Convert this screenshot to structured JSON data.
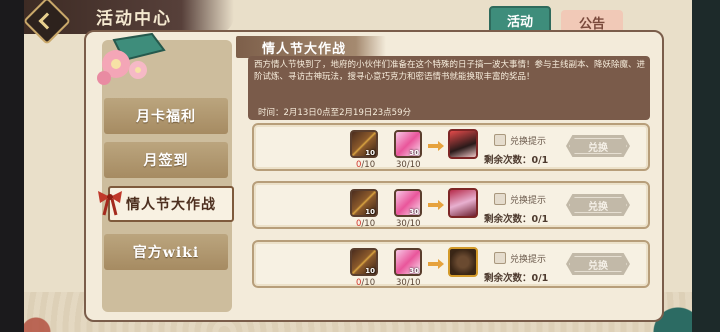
{
  "header": {
    "title": "活动中心",
    "back_icon": "back-diamond-icon"
  },
  "tabs": [
    {
      "label": "活动",
      "active": true
    },
    {
      "label": "公告",
      "active": false
    }
  ],
  "menu": [
    {
      "label": "月卡福利",
      "active": false
    },
    {
      "label": "月签到",
      "active": false
    },
    {
      "label": "情人节大作战",
      "active": true
    },
    {
      "label": "官方wiki",
      "active": false
    }
  ],
  "event": {
    "title": "情人节大作战",
    "description": "西方情人节快到了，地府的小伙伴们准备在这个特殊的日子搞一波大事情！参与主线副本、降妖除魔、进阶试炼、寻访古神玩法，搜寻心意巧克力和密语情书就能换取丰富的奖品！",
    "time": "时间：2月13日0点至2月19日23点59分"
  },
  "rows": [
    {
      "items": [
        {
          "icon": "chocolate-box-icon",
          "qty": "10",
          "owned": "0",
          "need": "/10"
        },
        {
          "icon": "love-letter-icon",
          "qty": "30",
          "owned": "30",
          "need": "/10"
        }
      ],
      "reward_icon": "character-portrait-icon",
      "hint_label": "兑换提示",
      "remain_label": "剩余次数：0/1",
      "button_label": "兑换"
    },
    {
      "items": [
        {
          "icon": "chocolate-box-icon",
          "qty": "10",
          "owned": "0",
          "need": "/10"
        },
        {
          "icon": "love-letter-icon",
          "qty": "30",
          "owned": "30",
          "need": "/10"
        }
      ],
      "reward_icon": "character-portrait-icon",
      "hint_label": "兑换提示",
      "remain_label": "剩余次数：0/1",
      "button_label": "兑换"
    },
    {
      "items": [
        {
          "icon": "chocolate-box-icon",
          "qty": "10",
          "owned": "0",
          "need": "/10"
        },
        {
          "icon": "love-letter-icon",
          "qty": "30",
          "owned": "30",
          "need": "/10"
        }
      ],
      "reward_icon": "treasure-item-icon",
      "hint_label": "兑换提示",
      "remain_label": "剩余次数：0/1",
      "button_label": "兑换"
    }
  ],
  "colors": {
    "tab_active": "#3e8d7b",
    "panel_brown": "#7a5b4a",
    "owned_red": "#d2352a"
  }
}
